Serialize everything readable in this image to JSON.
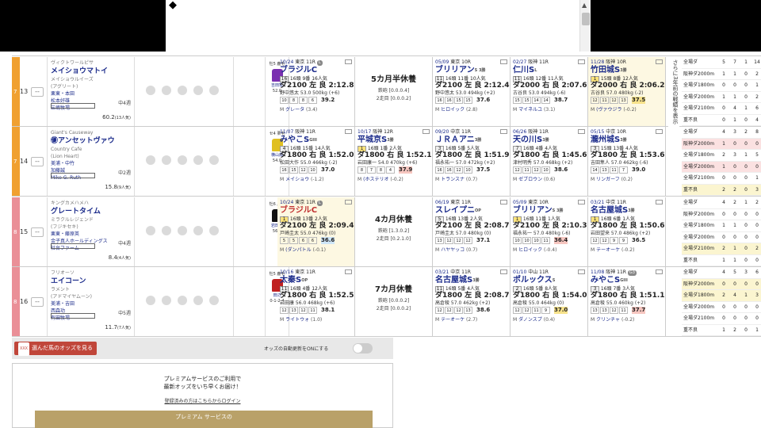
{
  "scroll_arrow": "▲",
  "rows": [
    {
      "frame_no": "7",
      "frame_color": "#f0a030",
      "horse_no": "13",
      "mark": "--",
      "sire": "ヴィクトワールピサ",
      "name": "メイショウマトイ",
      "dam": "メイショウルイーズ",
      "damsire": "(アグリート)",
      "trainer": "栗東・本田",
      "owner": "松本好雄",
      "breeder": "三嶋牧場",
      "weight_note": "中4週",
      "odds": "60.2",
      "pop": "(13人気)",
      "jockey_top": "牡5 鹿毛",
      "jockey_name": "吉田隼",
      "jockey_sub": "52.0",
      "silk": "#7a2fb0",
      "past": [
        {
          "date": "10/24",
          "place": "東京 11R",
          "tag": "L",
          "race": "ブラジルC",
          "grade": "",
          "l3": [
            "16",
            "16頭 9番 16人気"
          ],
          "win": false,
          "time": "ダ2100 左 良 2:12.8",
          "l5": "野中悠太 53.0 500kg (+6)",
          "l6": [
            "10",
            "8",
            "8",
            "6"
          ],
          "last": "39.2",
          "lastc": "",
          "l7": [
            "M",
            "グレータ",
            "(3.4)"
          ],
          "hl": false,
          "red": false
        },
        {
          "rest": true,
          "title": "5カ月半休養",
          "s1": "鉄砲 [0.0.0.4]",
          "s2": "2走目 [0.0.0.2]"
        },
        {
          "date": "05/09",
          "place": "東京 10R",
          "tag": "",
          "race": "ブリリアン",
          "grade": "S 3勝",
          "l3": [
            "11",
            "16頭 11番 10人気"
          ],
          "win": false,
          "time": "ダ2100 左 良 2:12.4",
          "l5": "野中悠太 53.0 494kg (+2)",
          "l6": [
            "16",
            "16",
            "15",
            "15"
          ],
          "last": "37.6",
          "lastc": "",
          "l7": [
            "M",
            "ヒロイック",
            "(2.8)"
          ],
          "hl": false,
          "red": false
        },
        {
          "date": "02/27",
          "place": "阪神 11R",
          "tag": "",
          "race": "仁川S",
          "grade": "L",
          "l3": [
            "11",
            "16頭 12番 11人気"
          ],
          "win": false,
          "time": "ダ2000 右 良 2:07.6",
          "l5": "古谷良 53.0 494kg (-6)",
          "l6": [
            "15",
            "15",
            "14",
            "14"
          ],
          "last": "38.7",
          "lastc": "",
          "l7": [
            "M",
            "マイネルユ",
            "(3.1)"
          ],
          "hl": false,
          "red": false
        },
        {
          "date": "11/28",
          "place": "阪神 10R",
          "tag": "",
          "race": "竹田城S",
          "grade": "3勝",
          "l3": [
            "1",
            "15頭 8番 12人気"
          ],
          "win": true,
          "time": "ダ2000 右 良 2:06.2",
          "l5": "古谷良 57.0 480kg (-2)",
          "l6": [
            "12",
            "11",
            "12",
            "13"
          ],
          "last": "37.5",
          "lastc": "y",
          "l7": [
            "M",
            "(ヴァウジラ",
            "(-0.2)"
          ],
          "hl": true,
          "red": false
        }
      ],
      "stats": [
        [
          "全場ダ",
          "5",
          "7",
          "1",
          "14"
        ],
        [
          "阪神ダ2000m",
          "1",
          "1",
          "0",
          "2"
        ],
        [
          "全場ダ1800m",
          "0",
          "0",
          "0",
          "1"
        ],
        [
          "全場ダ2000m",
          "1",
          "1",
          "0",
          "2"
        ],
        [
          "全場ダ2100m",
          "0",
          "4",
          "1",
          "6"
        ],
        [
          "重不良",
          "0",
          "1",
          "0",
          "4"
        ]
      ],
      "stats_hl": [
        "",
        "",
        "",
        "",
        "",
        ""
      ]
    },
    {
      "frame_no": "7",
      "frame_color": "#f0a030",
      "horse_no": "14",
      "mark": "--",
      "sire": "Giant's Causeway",
      "name": "㊝アンセットヴァウ",
      "dam": "Country Cafe",
      "damsire": "(Lion Heart)",
      "trainer": "美浦・中竹",
      "owner": "加藤誠",
      "breeder": "Mike G. Ruth",
      "weight_note": "中2週",
      "odds": "15.8",
      "pop": "(9人気)",
      "jockey_top": "セ4 栗毛",
      "jockey_name": "横山典",
      "jockey_sub": "54.0",
      "silk": "#e0c020",
      "past": [
        {
          "date": "11/07",
          "place": "阪神 11R",
          "tag": "",
          "race": "みやこS",
          "grade": "GIII",
          "l3": [
            "4",
            "16頭 15番 14人気"
          ],
          "win": false,
          "time": "ダ1800 右 良 1:52.0",
          "l5": "松田大作 55.0 466kg (-2)",
          "l6": [
            "16",
            "15",
            "12",
            "10"
          ],
          "last": "37.0",
          "lastc": "",
          "l7": [
            "M",
            "メイショウ",
            "(-1.2)"
          ],
          "hl": false,
          "red": false
        },
        {
          "date": "10/17",
          "place": "阪神 12R",
          "tag": "",
          "race": "平城京S",
          "grade": "3勝",
          "l3": [
            "1",
            "16頭 1番 2人気"
          ],
          "win": true,
          "time": "ダ1800 右 良 1:52.1",
          "l5": "岩田康一 54.0 470kg (+6)",
          "l6": [
            "8",
            "7",
            "8",
            "4"
          ],
          "last": "37.9",
          "lastc": "p",
          "l7": [
            "M",
            "(ホステリオ",
            "(-0.2)"
          ],
          "hl": false,
          "red": false
        },
        {
          "date": "09/20",
          "place": "中京 11R",
          "tag": "",
          "race": "ＪＲＡアニ",
          "grade": "3勝",
          "l3": [
            "3",
            "16頭 5番 5人気"
          ],
          "win": false,
          "time": "ダ1800 左 良 1:51.9",
          "l5": "福永祐一 57.0 472kg (+2)",
          "l6": [
            "16",
            "16",
            "12",
            "10"
          ],
          "last": "37.5",
          "lastc": "",
          "l7": [
            "M",
            "トランスナ",
            "(0.7)"
          ],
          "hl": false,
          "red": false
        },
        {
          "date": "06/26",
          "place": "阪神 11R",
          "tag": "",
          "race": "天の川S",
          "grade": "3勝",
          "l3": [
            "7",
            "16頭 4番 4人気"
          ],
          "win": false,
          "time": "ダ1800 右 良 1:45.6",
          "l5": "津村明秀 57.0 468kg (+2)",
          "l6": [
            "12",
            "11",
            "12",
            "10"
          ],
          "last": "38.6",
          "lastc": "",
          "l7": [
            "M",
            "ゼブロウン",
            "(0.6)"
          ],
          "hl": false,
          "red": false
        },
        {
          "date": "05/15",
          "place": "中京 10R",
          "tag": "",
          "race": "瀧州城S",
          "grade": "3勝",
          "l3": [
            "3",
            "15頭 13番 4人気"
          ],
          "win": false,
          "time": "ダ1800 左 良 1:53.6",
          "l5": "吉田隼人 57.0 462kg (-6)",
          "l6": [
            "14",
            "13",
            "11",
            "7"
          ],
          "last": "39.0",
          "lastc": "",
          "l7": [
            "M",
            "リンガーフ",
            "(0.2)"
          ],
          "hl": false,
          "red": false
        }
      ],
      "stats": [
        [
          "全場ダ",
          "4",
          "3",
          "2",
          "8"
        ],
        [
          "阪神ダ2000m",
          "1",
          "0",
          "0",
          "0"
        ],
        [
          "全場ダ1800m",
          "2",
          "3",
          "1",
          "5"
        ],
        [
          "全場ダ2000m",
          "1",
          "0",
          "0",
          "0"
        ],
        [
          "全場ダ2100m",
          "0",
          "0",
          "0",
          "1"
        ],
        [
          "重不良",
          "2",
          "2",
          "0",
          "3"
        ]
      ],
      "stats_hl": [
        "",
        "pk",
        "",
        "pk",
        "",
        "yl"
      ]
    },
    {
      "frame_no": "8",
      "frame_color": "#ea8f97",
      "horse_no": "15",
      "mark": "--",
      "sire": "キングカメハメハ",
      "name": "グレートタイム",
      "dam": "ミラクルレジェンド",
      "damsire": "(フジキセキ)",
      "trainer": "栗東・藤原英",
      "owner": "金子真人ホールディングス",
      "breeder": "社台ファーム",
      "weight_note": "中4週",
      "odds": "8.4",
      "pop": "(4人気)",
      "jockey_top": "牡6 鹿毛",
      "jockey_name": "岩田望",
      "jockey_sub": "56.0",
      "silk": "#111111",
      "past": [
        {
          "date": "10/24",
          "place": "東京 11R",
          "tag": "L",
          "race": "ブラジルC",
          "grade": "",
          "l3": [
            "1",
            "16頭 13番 2人気"
          ],
          "win": true,
          "time": "ダ2100 左 良 2:09.4",
          "l5": "戸崎圭太 55.0 476kg (0)",
          "l6": [
            "5",
            "5",
            "6",
            "6"
          ],
          "last": "36.6",
          "lastc": "b",
          "l7": [
            "M",
            "(ダンパトル",
            "(-0.1)"
          ],
          "hl": true,
          "red": true
        },
        {
          "rest": true,
          "title": "4カ月休養",
          "s1": "鉄砲 [1.3.0.2]",
          "s2": "2走目 [0.2.1.0]"
        },
        {
          "date": "06/19",
          "place": "東京 11R",
          "tag": "",
          "race": "スレイプニ",
          "grade": "OP",
          "l3": [
            "5",
            "16頭 13番 2人気"
          ],
          "win": false,
          "time": "ダ2100 左 良 2:08.7",
          "l5": "戸崎圭太 57.0 480kg (0)",
          "l6": [
            "13",
            "12",
            "12",
            "12"
          ],
          "last": "37.1",
          "lastc": "",
          "l7": [
            "M",
            "ハヤヤッコ",
            "(0.7)"
          ],
          "hl": false,
          "red": false
        },
        {
          "date": "05/09",
          "place": "東京 10R",
          "tag": "",
          "race": "ブリリアン",
          "grade": "S 3勝",
          "l3": [
            "1",
            "16頭 11番 1人気"
          ],
          "win": true,
          "time": "ダ2100 左 良 2:10.3",
          "l5": "福永祐一 57.0 480kg (-6)",
          "l6": [
            "10",
            "10",
            "10",
            "11"
          ],
          "last": "36.4",
          "lastc": "p",
          "l7": [
            "M",
            "ヒロイック",
            "(-0.4)"
          ],
          "hl": false,
          "red": false
        },
        {
          "date": "03/21",
          "place": "中京 11R",
          "tag": "",
          "race": "名古屋城S",
          "grade": "3勝",
          "l3": [
            "1",
            "16頭 6番 1人気"
          ],
          "win": true,
          "time": "ダ1800 左 良 1:50.6",
          "l5": "岩田望来 57.0 486kg (+2)",
          "l6": [
            "12",
            "12",
            "9",
            "9"
          ],
          "last": "36.5",
          "lastc": "",
          "l7": [
            "M",
            "テーオーケ",
            "(-0.2)"
          ],
          "hl": false,
          "red": false
        }
      ],
      "stats": [
        [
          "全場ダ",
          "4",
          "2",
          "1",
          "2"
        ],
        [
          "阪神ダ2000m",
          "0",
          "0",
          "0",
          "0"
        ],
        [
          "全場ダ1800m",
          "1",
          "1",
          "0",
          "0"
        ],
        [
          "全場ダ2000m",
          "0",
          "0",
          "0",
          "0"
        ],
        [
          "全場ダ2100m",
          "2",
          "1",
          "0",
          "2"
        ],
        [
          "重不良",
          "1",
          "1",
          "0",
          "0"
        ]
      ],
      "stats_hl": [
        "",
        "",
        "",
        "",
        "yl",
        ""
      ]
    },
    {
      "frame_no": "8",
      "frame_color": "#ea8f97",
      "horse_no": "16",
      "mark": "--",
      "sire": "フリオーソ",
      "name": "エイコーン",
      "dam": "ラメント",
      "damsire": "(アドマイヤムーン)",
      "trainer": "美浦・吉田",
      "owner": "西森功",
      "breeder": "有田牧場",
      "weight_note": "中5週",
      "odds": "11.7",
      "pop": "(7人気)",
      "jockey_top": "牡5 鹿毛",
      "jockey_name": "田辺",
      "jockey_sub": "0-1-2-4",
      "silk": "#c02020",
      "past": [
        {
          "date": "10/16",
          "place": "東京 11R",
          "tag": "",
          "race": "太秦S",
          "grade": "OP",
          "l3": [
            "11",
            "16頭 4番 12人気"
          ],
          "win": false,
          "time": "ダ1800 右 良 1:52.5",
          "l5": "岩田康 56.0 468kg (+6)",
          "l6": [
            "12",
            "13",
            "12",
            "11"
          ],
          "last": "38.1",
          "lastc": "",
          "l7": [
            "M",
            "ライトウォ",
            "(1.0)"
          ],
          "hl": false,
          "red": false
        },
        {
          "rest": true,
          "title": "7カ月休養",
          "s1": "鉄砲 [0.0.0.2]",
          "s2": "2走目 [0.0.0.2]"
        },
        {
          "date": "03/21",
          "place": "中京 11R",
          "tag": "",
          "race": "名古屋城S",
          "grade": "3勝",
          "l3": [
            "11",
            "16頭 5番 4人気"
          ],
          "win": false,
          "time": "ダ1800 左 良 2:08.7",
          "l5": "高倉稜 57.0 462kg (+2)",
          "l6": [
            "12",
            "12",
            "12",
            "13"
          ],
          "last": "38.6",
          "lastc": "",
          "l7": [
            "M",
            "テーオーケ",
            "(2.7)"
          ],
          "hl": false,
          "red": false
        },
        {
          "date": "01/10",
          "place": "中山 11R",
          "tag": "",
          "race": "ポルックス",
          "grade": "S",
          "l3": [
            "2",
            "16頭 5番 8人気"
          ],
          "win": false,
          "time": "ダ1800 右 良 1:54.0",
          "l5": "高倉稜 55.0 464kg (0)",
          "l6": [
            "12",
            "12",
            "11",
            "9"
          ],
          "last": "37.0",
          "lastc": "y",
          "l7": [
            "M",
            "ダノンスプ",
            "(0.4)"
          ],
          "hl": false,
          "red": false
        },
        {
          "date": "11/08",
          "place": "阪神 11R",
          "tag": "G3",
          "race": "みやこS",
          "grade": "GIII",
          "l3": [
            "3",
            "16頭 7番 3人気"
          ],
          "win": false,
          "time": "ダ1800 右 良 1:51.1",
          "l5": "高倉稜 55.0 460kg (+2)",
          "l6": [
            "13",
            "13",
            "12",
            "11"
          ],
          "last": "37.7",
          "lastc": "p",
          "l7": [
            "M",
            "クリンチャ",
            "(-0.2)"
          ],
          "hl": false,
          "red": false
        }
      ],
      "stats": [
        [
          "全場ダ",
          "4",
          "5",
          "3",
          "6"
        ],
        [
          "阪神ダ2000m",
          "0",
          "0",
          "0",
          "0"
        ],
        [
          "全場ダ1800m",
          "2",
          "4",
          "1",
          "3"
        ],
        [
          "全場ダ2000m",
          "0",
          "0",
          "0",
          "0"
        ],
        [
          "全場ダ2100m",
          "0",
          "0",
          "0",
          "0"
        ],
        [
          "重不良",
          "1",
          "2",
          "0",
          "1"
        ]
      ],
      "stats_hl": [
        "",
        "yl",
        "yl",
        "",
        "",
        ""
      ]
    }
  ],
  "side_tab": "さらに3年前の戦績を表示",
  "odds_button": {
    "icon": "XXX",
    "label": "選んだ馬のオッズを見る"
  },
  "auto_update_label": "オッズの自動更新をONにする",
  "promo": {
    "line1": "プレミアムサービスのご利用で",
    "line2": "最新オッズをいち早くお届け！",
    "login": "登録済みの方はこちらからログイン",
    "button": "プレミアム サービスの"
  },
  "colors": {
    "frame7": "#f0a030",
    "frame8": "#ea8f97",
    "accent_red": "#c0463a",
    "promo_gold": "#b9a169",
    "name_blue": "#1a2a8a"
  }
}
